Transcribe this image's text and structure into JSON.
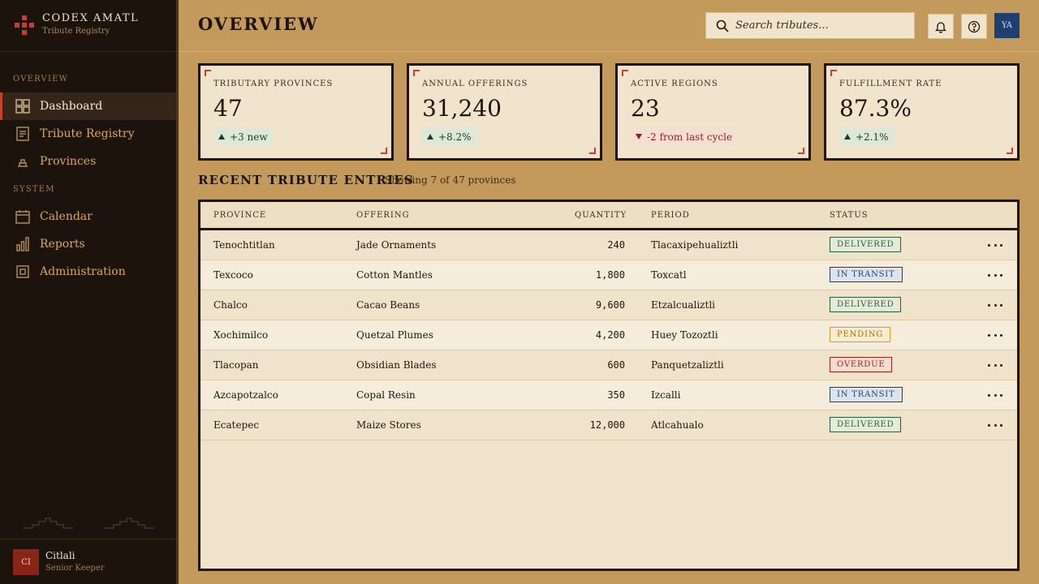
{
  "brand": {
    "title": "CODEX AMATL",
    "subtitle": "Tribute Registry"
  },
  "sidebar": {
    "sections": [
      {
        "label": "OVERVIEW"
      },
      {
        "label": "SYSTEM"
      }
    ],
    "items": [
      {
        "label": "Dashboard",
        "icon": "dashboard-icon",
        "active": true
      },
      {
        "label": "Tribute Registry",
        "icon": "registry-icon"
      },
      {
        "label": "Provinces",
        "icon": "temple-icon"
      },
      {
        "label": "Calendar",
        "icon": "calendar-icon"
      },
      {
        "label": "Reports",
        "icon": "bar-chart-icon"
      },
      {
        "label": "Administration",
        "icon": "admin-icon"
      }
    ]
  },
  "user": {
    "initials": "CI",
    "name": "Citlali",
    "role": "Senior Keeper"
  },
  "header": {
    "title": "OVERVIEW",
    "search_placeholder": "Search tributes...",
    "avatar_initials": "YA"
  },
  "colors": {
    "accent": "#c8402a",
    "background": "#c49a5c",
    "sidebar": "#1c130c",
    "card": "#f0e4cc"
  },
  "stats": [
    {
      "label": "TRIBUTARY PROVINCES",
      "value": "47",
      "delta": "+3 new",
      "direction": "up"
    },
    {
      "label": "ANNUAL OFFERINGS",
      "value": "31,240",
      "delta": "+8.2%",
      "direction": "up"
    },
    {
      "label": "ACTIVE REGIONS",
      "value": "23",
      "delta": "-2 from last cycle",
      "direction": "down"
    },
    {
      "label": "FULFILLMENT RATE",
      "value": "87.3%",
      "delta": "+2.1%",
      "direction": "up"
    }
  ],
  "entries": {
    "title": "RECENT TRIBUTE ENTRIES",
    "subtitle": "Showing 7 of 47 provinces",
    "columns": [
      "PROVINCE",
      "OFFERING",
      "QUANTITY",
      "PERIOD",
      "STATUS"
    ],
    "rows": [
      {
        "province": "Tenochtitlan",
        "offering": "Jade Ornaments",
        "quantity": "240",
        "period": "Tlacaxipehualiztli",
        "status": "DELIVERED",
        "kind": "delivered"
      },
      {
        "province": "Texcoco",
        "offering": "Cotton Mantles",
        "quantity": "1,800",
        "period": "Toxcatl",
        "status": "IN TRANSIT",
        "kind": "transit"
      },
      {
        "province": "Chalco",
        "offering": "Cacao Beans",
        "quantity": "9,600",
        "period": "Etzalcualiztli",
        "status": "DELIVERED",
        "kind": "delivered"
      },
      {
        "province": "Xochimilco",
        "offering": "Quetzal Plumes",
        "quantity": "4,200",
        "period": "Huey Tozoztli",
        "status": "PENDING",
        "kind": "pending"
      },
      {
        "province": "Tlacopan",
        "offering": "Obsidian Blades",
        "quantity": "600",
        "period": "Panquetzaliztli",
        "status": "OVERDUE",
        "kind": "overdue"
      },
      {
        "province": "Azcapotzalco",
        "offering": "Copal Resin",
        "quantity": "350",
        "period": "Izcalli",
        "status": "IN TRANSIT",
        "kind": "transit"
      },
      {
        "province": "Ecatepec",
        "offering": "Maize Stores",
        "quantity": "12,000",
        "period": "Atlcahualo",
        "status": "DELIVERED",
        "kind": "delivered"
      }
    ]
  }
}
